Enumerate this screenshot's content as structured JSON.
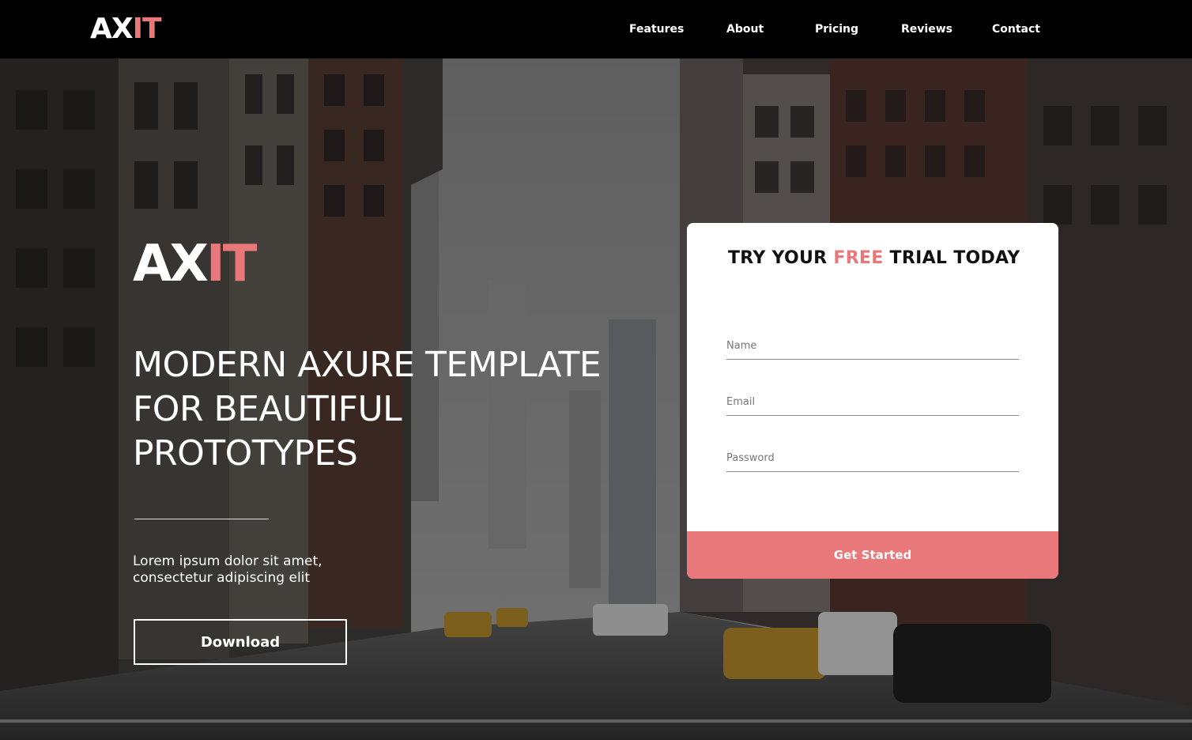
{
  "header": {
    "logo_main": "AX",
    "logo_accent": "IT",
    "nav": [
      {
        "label": "Features"
      },
      {
        "label": "About"
      },
      {
        "label": "Pricing"
      },
      {
        "label": "Reviews"
      },
      {
        "label": "Contact"
      }
    ]
  },
  "hero": {
    "logo_main": "AX",
    "logo_accent": "IT",
    "headline_line1": "MODERN AXURE TEMPLATE",
    "headline_line2": "FOR BEAUTIFUL",
    "headline_line3": "PROTOTYPES",
    "subtext_line1": "Lorem ipsum dolor sit amet,",
    "subtext_line2": "consectetur adipiscing elit",
    "download_label": "Download"
  },
  "signup": {
    "title_before": "TRY YOUR ",
    "title_accent": "FREE",
    "title_after": " TRIAL TODAY",
    "name_placeholder": "Name",
    "email_placeholder": "Email",
    "password_placeholder": "Password",
    "submit_label": "Get Started"
  },
  "colors": {
    "accent": "#e9787a",
    "topbar": "#000000",
    "card": "#ffffff"
  },
  "icons": {
    "background": "city-street-photo"
  }
}
